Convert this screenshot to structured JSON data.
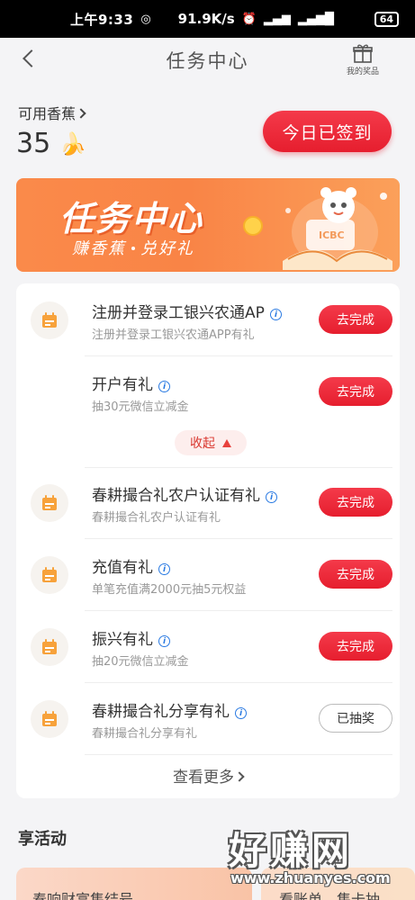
{
  "status_bar": {
    "time": "上午9:33",
    "speed": "91.9K/s",
    "battery": "64"
  },
  "nav": {
    "title": "任务中心",
    "prizes_label": "我的奖品"
  },
  "bananas": {
    "label": "可用香蕉",
    "count": "35"
  },
  "signin_button": "今日已签到",
  "banner": {
    "title": "任务中心",
    "subtitle_left": "赚香蕉",
    "subtitle_right": "兑好礼",
    "logo_text": "ICBC"
  },
  "tasks": [
    {
      "title": "注册并登录工银兴农通AP",
      "desc": "注册并登录工银兴农通APP有礼",
      "action": "去完成"
    },
    {
      "title": "开户有礼",
      "desc": "抽30元微信立减金",
      "action": "去完成"
    },
    {
      "title": "春耕撮合礼农户认证有礼",
      "desc": "春耕撮合礼农户认证有礼",
      "action": "去完成"
    },
    {
      "title": "充值有礼",
      "desc": "单笔充值满2000元抽5元权益",
      "action": "去完成"
    },
    {
      "title": "振兴有礼",
      "desc": "抽20元微信立减金",
      "action": "去完成"
    },
    {
      "title": "春耕撮合礼分享有礼",
      "desc": "春耕撮合礼分享有礼",
      "action": "已抽奖"
    }
  ],
  "collapse_label": "收起",
  "more_label": "查看更多",
  "section_title": "享活动",
  "activities": [
    {
      "text": "春响财富集结号"
    },
    {
      "text": "看账单，集卡抽"
    }
  ],
  "watermark": {
    "big": "好赚网",
    "small": "www.zhuanyes.com"
  },
  "colors": {
    "accent": "#e61e2e",
    "banner": "#f98446",
    "info": "#2a7ae2",
    "background": "#f4f4f6"
  }
}
